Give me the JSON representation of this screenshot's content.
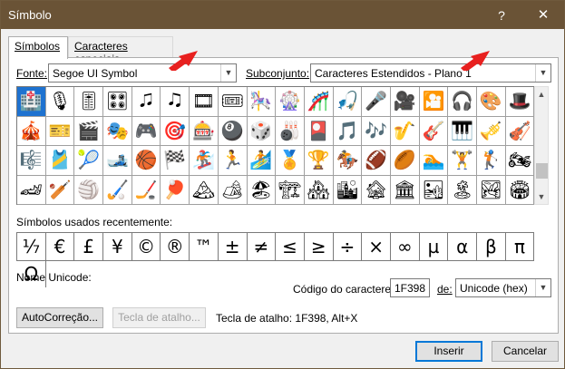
{
  "window": {
    "title": "Símbolo",
    "help_glyph": "?",
    "close_glyph": "✕"
  },
  "tabs": [
    {
      "label": "Símbolos",
      "active": true
    },
    {
      "label": "Caracteres especiais",
      "active": false
    }
  ],
  "font": {
    "label": "Fonte:",
    "value": "Segoe UI Symbol"
  },
  "subset": {
    "label": "Subconjunto:",
    "value": "Caracteres Estendidos - Plano 1"
  },
  "symbol_grid": {
    "rows": [
      [
        "🏥",
        "🎙",
        "🎚",
        "🎛",
        "🎜",
        "🎝",
        "🎞",
        "🎟",
        "🎠",
        "🎡",
        "🎢",
        "🎣",
        "🎤",
        "🎥",
        "🎦",
        "🎧",
        "🎨",
        "🎩"
      ],
      [
        "🎪",
        "🎫",
        "🎬",
        "🎭",
        "🎮",
        "🎯",
        "🎰",
        "🎱",
        "🎲",
        "🎳",
        "🎴",
        "🎵",
        "🎶",
        "🎷",
        "🎸",
        "🎹",
        "🎺",
        "🎻"
      ],
      [
        "🎼",
        "🎽",
        "🎾",
        "🎿",
        "🏀",
        "🏁",
        "🏂",
        "🏃",
        "🏄",
        "🏅",
        "🏆",
        "🏇",
        "🏈",
        "🏉",
        "🏊",
        "🏋",
        "🏌",
        "🏍"
      ],
      [
        "🏎",
        "🏏",
        "🏐",
        "🏑",
        "🏒",
        "🏓",
        "🏔",
        "🏕",
        "🏖",
        "🏗",
        "🏘",
        "🏙",
        "🏚",
        "🏛",
        "🏜",
        "🏝",
        "🏞",
        "🏟"
      ]
    ],
    "selected": [
      0,
      0
    ]
  },
  "recent": {
    "label": "Símbolos usados recentemente:",
    "symbols": [
      "⅐",
      "€",
      "£",
      "¥",
      "©",
      "®",
      "™",
      "±",
      "≠",
      "≤",
      "≥",
      "÷",
      "×",
      "∞",
      "µ",
      "α",
      "β",
      "π",
      "Ω"
    ]
  },
  "unicode_name": {
    "label": "Nome Unicode:"
  },
  "char_code": {
    "label": "Código do caractere:",
    "value": "1F398"
  },
  "from": {
    "label": "de:",
    "value": "Unicode (hex)"
  },
  "autocorrect_button": "AutoCorreção...",
  "shortcut_key_button": "Tecla de atalho...",
  "shortcut_text": "Tecla de atalho: 1F398, Alt+X",
  "insert_button": "Inserir",
  "cancel_button": "Cancelar",
  "colors": {
    "title_bar": "#6a5336",
    "selection": "#1e72d0",
    "annotation_arrow": "#e8201f"
  },
  "icons": {
    "combo_arrow": "chevron-down-icon",
    "scroll_up": "chevron-up-icon",
    "scroll_down": "chevron-down-icon"
  }
}
